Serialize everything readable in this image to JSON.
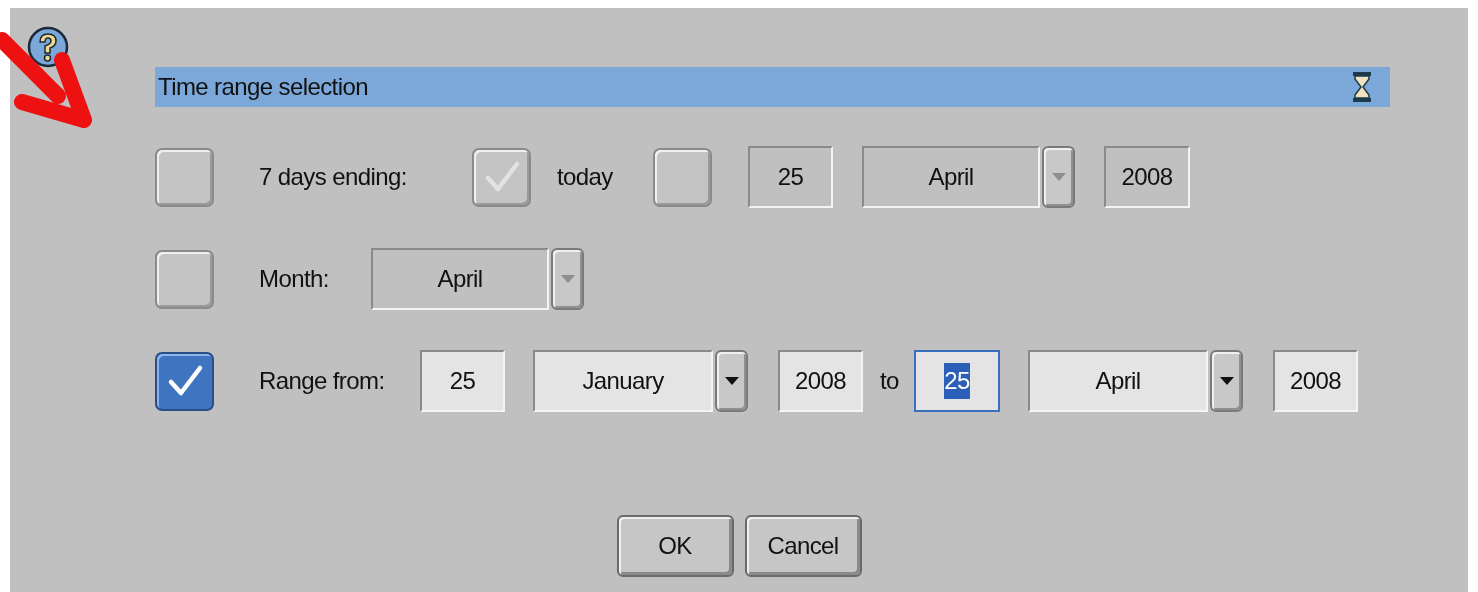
{
  "title": "Time range selection",
  "options": [
    {
      "kind": "days",
      "checked": false,
      "label": "7 days ending:",
      "today": {
        "checked": true,
        "label": "today"
      },
      "custom": {
        "checked": false
      },
      "day": "25",
      "month": "April",
      "year": "2008"
    },
    {
      "kind": "month",
      "checked": false,
      "label": "Month:",
      "month": "April"
    },
    {
      "kind": "range",
      "checked": true,
      "label": "Range from:",
      "from": {
        "day": "25",
        "month": "January",
        "year": "2008",
        "focused": false
      },
      "to_label": "to",
      "to": {
        "day": "25",
        "month": "April",
        "year": "2008",
        "focused": true
      }
    }
  ],
  "buttons": [
    "OK",
    "Cancel"
  ]
}
